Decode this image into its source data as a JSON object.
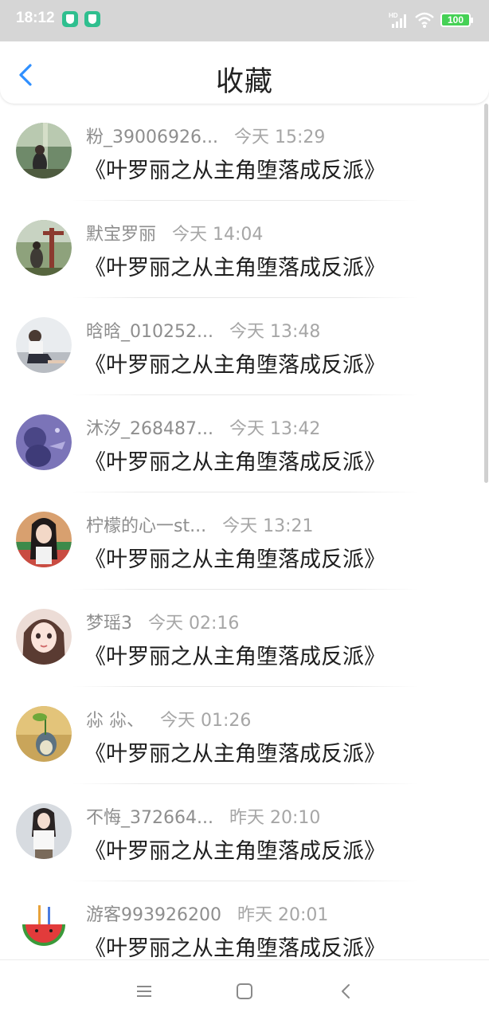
{
  "status_bar": {
    "time": "18:12",
    "battery": "100",
    "hd_label": "HD",
    "icons": [
      "shield-icon",
      "shield-icon",
      "hd-signal-icon",
      "wifi-icon",
      "battery-icon"
    ]
  },
  "header": {
    "title": "收藏",
    "back_icon": "chevron-left-icon",
    "accent_color": "#2f8fff"
  },
  "favorites": [
    {
      "name": "粉_39006926...",
      "time": "今天 15:29",
      "book": "《叶罗丽之从主角堕落成反派》"
    },
    {
      "name": "默宝罗丽",
      "time": "今天 14:04",
      "book": "《叶罗丽之从主角堕落成反派》"
    },
    {
      "name": "晗晗_010252...",
      "time": "今天 13:48",
      "book": "《叶罗丽之从主角堕落成反派》"
    },
    {
      "name": "沐汐_268487...",
      "time": "今天 13:42",
      "book": "《叶罗丽之从主角堕落成反派》"
    },
    {
      "name": "柠檬的心一st...",
      "time": "今天 13:21",
      "book": "《叶罗丽之从主角堕落成反派》"
    },
    {
      "name": "梦瑶3",
      "time": "今天 02:16",
      "book": "《叶罗丽之从主角堕落成反派》"
    },
    {
      "name": "尛 尛、",
      "time": "今天 01:26",
      "book": "《叶罗丽之从主角堕落成反派》"
    },
    {
      "name": "不悔_372664...",
      "time": "昨天 20:10",
      "book": "《叶罗丽之从主角堕落成反派》"
    },
    {
      "name": "游客993926200",
      "time": "昨天 20:01",
      "book": "《叶罗丽之从主角堕落成反派》"
    }
  ],
  "nav_bar": {
    "icons": [
      "menu-icon",
      "home-square-icon",
      "back-icon"
    ]
  }
}
